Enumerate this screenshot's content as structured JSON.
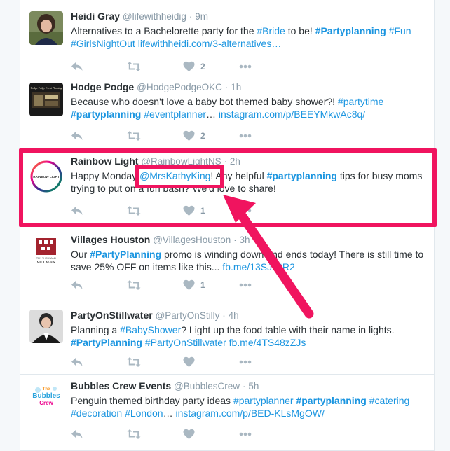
{
  "colors": {
    "accent_link": "#1b95e0",
    "highlight": "#f0145f",
    "muted": "#8899a6"
  },
  "tweets": [
    {
      "name": "Heidi Gray",
      "handle": "@lifewithheidig",
      "time": "9m",
      "segments": [
        {
          "t": "Alternatives to a Bachelorette party for the ",
          "s": "plain"
        },
        {
          "t": "#Bride",
          "s": "link"
        },
        {
          "t": " to be! ",
          "s": "plain"
        },
        {
          "t": "#Partyplanning",
          "s": "tagb"
        },
        {
          "t": " ",
          "s": "plain"
        },
        {
          "t": "#Fun",
          "s": "link"
        },
        {
          "t": " ",
          "s": "plain"
        },
        {
          "t": "#GirlsNightOut",
          "s": "link"
        },
        {
          "t": " ",
          "s": "plain"
        },
        {
          "t": "lifewithheidi.com/3-alternatives…",
          "s": "link"
        }
      ],
      "likes": "2"
    },
    {
      "name": "Hodge Podge",
      "handle": "@HodgePodgeOKC",
      "time": "1h",
      "segments": [
        {
          "t": "Because who doesn't love a baby bot themed baby shower?! ",
          "s": "plain"
        },
        {
          "t": "#partytime",
          "s": "link"
        },
        {
          "t": " ",
          "s": "plain"
        },
        {
          "t": "#partyplanning",
          "s": "tagb"
        },
        {
          "t": " ",
          "s": "plain"
        },
        {
          "t": "#eventplanner",
          "s": "link"
        },
        {
          "t": "… ",
          "s": "plain"
        },
        {
          "t": "instagram.com/p/BEEYMkwAc8q/",
          "s": "link"
        }
      ],
      "likes": "2"
    },
    {
      "name": "Rainbow Light",
      "handle": "@RainbowLightNS",
      "time": "2h",
      "segments": [
        {
          "t": "Happy Monday ",
          "s": "plain"
        },
        {
          "t": "@MrsKathyKing",
          "s": "link"
        },
        {
          "t": "! Any helpful ",
          "s": "plain"
        },
        {
          "t": "#partyplanning",
          "s": "tagb"
        },
        {
          "t": " tips for busy moms trying to put on a fun bash? We'd love to share!",
          "s": "plain"
        }
      ],
      "likes": "1"
    },
    {
      "name": "Villages Houston",
      "handle": "@VillagesHouston",
      "time": "3h",
      "segments": [
        {
          "t": "Our ",
          "s": "plain"
        },
        {
          "t": "#PartyPlanning",
          "s": "tagb"
        },
        {
          "t": " promo is winding down and ends today! There is still time to save 25% OFF on items like this... ",
          "s": "plain"
        },
        {
          "t": "fb.me/13SJi6tR2",
          "s": "link"
        }
      ],
      "likes": "1"
    },
    {
      "name": "PartyOnStillwater",
      "handle": "@PartyOnStilly",
      "time": "4h",
      "segments": [
        {
          "t": "Planning a ",
          "s": "plain"
        },
        {
          "t": "#BabyShower",
          "s": "link"
        },
        {
          "t": "?  Light up the food table with their name in lights. ",
          "s": "plain"
        },
        {
          "t": "#PartyPlanning",
          "s": "tagb"
        },
        {
          "t": " ",
          "s": "plain"
        },
        {
          "t": "#PartyOnStillwater",
          "s": "link"
        },
        {
          "t": " ",
          "s": "plain"
        },
        {
          "t": "fb.me/4TS48zZJs",
          "s": "link"
        }
      ],
      "likes": ""
    },
    {
      "name": "Bubbles Crew Events",
      "handle": "@BubblesCrew",
      "time": "5h",
      "segments": [
        {
          "t": "Penguin themed birthday party ideas ",
          "s": "plain"
        },
        {
          "t": "#partyplanner",
          "s": "link"
        },
        {
          "t": " ",
          "s": "plain"
        },
        {
          "t": "#partyplanning",
          "s": "tagb"
        },
        {
          "t": " ",
          "s": "plain"
        },
        {
          "t": "#catering",
          "s": "link"
        },
        {
          "t": " ",
          "s": "plain"
        },
        {
          "t": "#decoration",
          "s": "link"
        },
        {
          "t": " ",
          "s": "plain"
        },
        {
          "t": "#London",
          "s": "link"
        },
        {
          "t": "… ",
          "s": "plain"
        },
        {
          "t": "instagram.com/p/BED-KLsMgOW/",
          "s": "link"
        }
      ],
      "likes": ""
    }
  ],
  "avatars": {
    "hodge": "Hodge Podge Event Planning",
    "rainbow": "RAINBOW LIGHT",
    "villages_line1": "TEN THOUSAND",
    "villages_line2": "VILLAGES.",
    "bubbles_line1": "The",
    "bubbles_line2": "Bubbles",
    "bubbles_line3": "Crew"
  },
  "icons": [
    "reply-icon",
    "retweet-icon",
    "heart-icon",
    "more-icon"
  ]
}
